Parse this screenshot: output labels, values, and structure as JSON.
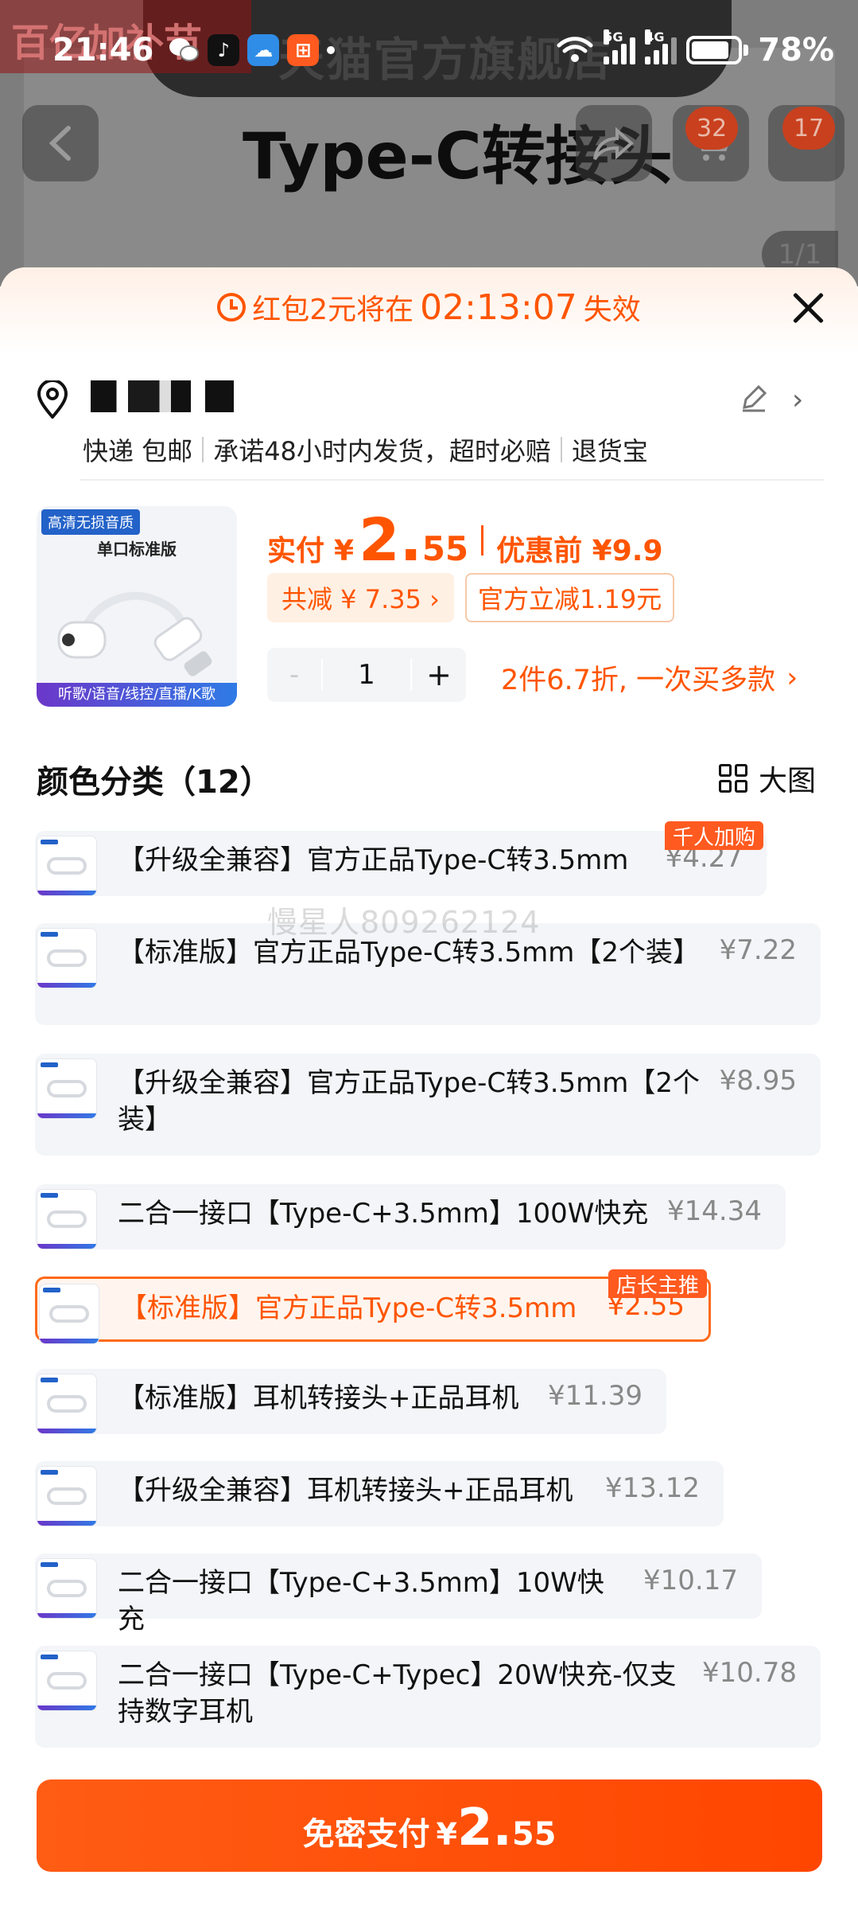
{
  "status_bar": {
    "time": "21:46",
    "battery": "78%",
    "network": [
      "5G",
      "4G"
    ]
  },
  "background": {
    "store_name": "天猫官方旗舰店",
    "title": "Type-C转接头",
    "cart_badge": "32",
    "more_badge": "17",
    "image_counter": "1/1",
    "watermark": "百亿加补节"
  },
  "sheet": {
    "countdown": {
      "prefix": "红包2元将在",
      "timer": "02:13:07",
      "suffix": "失效"
    },
    "address": {
      "services": [
        "快递 包邮",
        "承诺48小时内发货，超时必赔",
        "退货宝"
      ]
    },
    "product": {
      "thumb_badge": "高清无损音质",
      "thumb_title": "单口标准版",
      "thumb_footer": "听歌/语音/线控/直播/K歌",
      "price_label": "实付",
      "price_currency": "¥",
      "price_integer": "2.",
      "price_decimal": "55",
      "original_price": "优惠前 ¥9.9",
      "saving_tag": "共减 ¥ 7.35 ›",
      "official_tag": "官方立减1.19元",
      "quantity_minus": "-",
      "quantity": "1",
      "quantity_plus": "+",
      "multi_offer": "2件6.7折, 一次买多款",
      "multi_offer_chevron": "›"
    },
    "options_header": "颜色分类（12）",
    "big_view_label": "大图",
    "options": [
      {
        "name": "【升级全兼容】官方正品Type-C转3.5mm",
        "price": "¥4.27",
        "tag": "千人加购"
      },
      {
        "name": "【标准版】官方正品Type-C转3.5mm【2个装】",
        "price": "¥7.22",
        "tag": ""
      },
      {
        "name": "【升级全兼容】官方正品Type-C转3.5mm【2个装】",
        "price": "¥8.95",
        "tag": ""
      },
      {
        "name": "二合一接口【Type-C+3.5mm】100W快充",
        "price": "¥14.34",
        "tag": ""
      },
      {
        "name": "【标准版】官方正品Type-C转3.5mm",
        "price": "¥2.55",
        "tag": "店长主推"
      },
      {
        "name": "【标准版】耳机转接头+正品耳机",
        "price": "¥11.39",
        "tag": ""
      },
      {
        "name": "【升级全兼容】耳机转接头+正品耳机",
        "price": "¥13.12",
        "tag": ""
      },
      {
        "name": "二合一接口【Type-C+3.5mm】10W快充",
        "price": "¥10.17",
        "tag": ""
      },
      {
        "name": "二合一接口【Type-C+Typec】20W快充-仅支持数字耳机",
        "price": "¥10.78",
        "tag": ""
      }
    ],
    "watermark": "慢星人809262124",
    "pay_button": {
      "label": "免密支付",
      "currency": "¥",
      "integer": "2.",
      "decimal": "55"
    }
  }
}
